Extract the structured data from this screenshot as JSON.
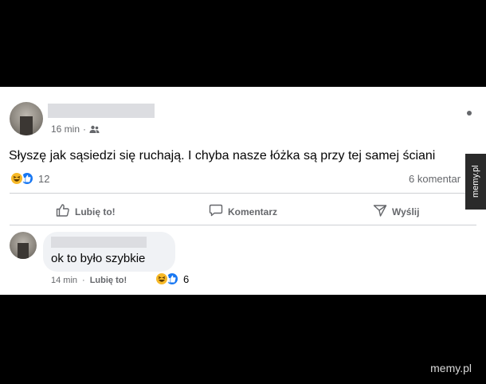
{
  "post": {
    "time": "16 min",
    "separator": "·",
    "audience_icon": "friends-icon",
    "text": "Słyszę jak sąsiedzi się ruchają. I chyba nasze łóżka są przy tej samej ściani",
    "reactions": {
      "icons": [
        "haha-icon",
        "like-icon"
      ],
      "count": "12"
    },
    "comments_count": "6 komentar"
  },
  "actions": {
    "like": "Lubię to!",
    "comment": "Komentarz",
    "share": "Wyślij"
  },
  "comment": {
    "text": "ok to było szybkie",
    "time": "14 min",
    "separator": "·",
    "like_label": "Lubię to!",
    "reactions": {
      "icons": [
        "haha-icon",
        "like-icon"
      ],
      "count": "6"
    }
  },
  "watermarks": {
    "side": "memy.pl",
    "bottom": "memy.pl"
  },
  "colors": {
    "like_blue": "#1877f2",
    "haha_yellow": "#f7b928",
    "meta_gray": "#65676b"
  }
}
